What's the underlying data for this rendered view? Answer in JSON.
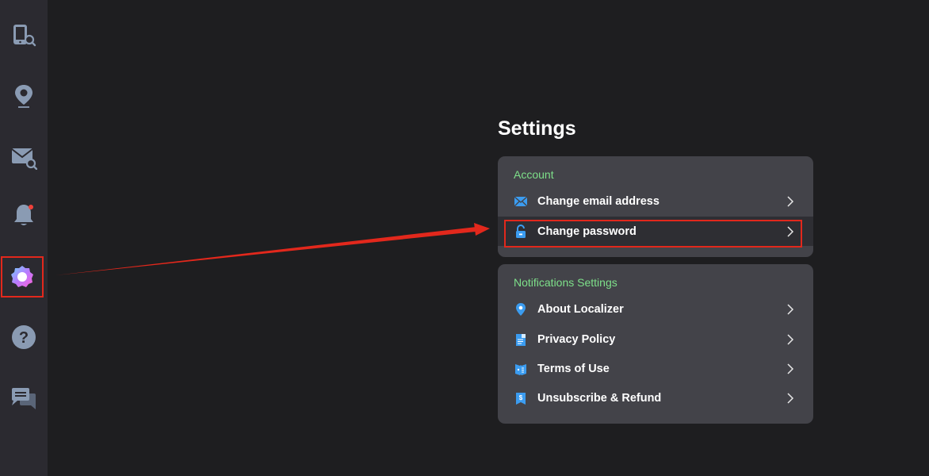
{
  "sidebar": {
    "items": [
      {
        "name": "device-search",
        "icon": "phone-search-icon",
        "active": false
      },
      {
        "name": "location",
        "icon": "map-pin-icon",
        "active": false
      },
      {
        "name": "mail-search",
        "icon": "mail-search-icon",
        "active": false
      },
      {
        "name": "notifications",
        "icon": "bell-icon",
        "active": false,
        "badge": true
      },
      {
        "name": "settings",
        "icon": "gear-icon",
        "active": true
      },
      {
        "name": "help",
        "icon": "help-icon",
        "active": false
      },
      {
        "name": "chat",
        "icon": "chat-icon",
        "active": false
      }
    ]
  },
  "page": {
    "title": "Settings"
  },
  "account": {
    "section_label": "Account",
    "items": [
      {
        "label": "Change email address",
        "icon": "envelope-icon"
      },
      {
        "label": "Change password",
        "icon": "unlock-icon"
      }
    ]
  },
  "notifications": {
    "section_label": "Notifications Settings",
    "items": [
      {
        "label": "About Localizer",
        "icon": "map-pin-icon"
      },
      {
        "label": "Privacy Policy",
        "icon": "document-icon"
      },
      {
        "label": "Terms of Use",
        "icon": "book-icon"
      },
      {
        "label": "Unsubscribe & Refund",
        "icon": "receipt-icon"
      }
    ]
  },
  "colors": {
    "accent_green": "#7ee08a",
    "icon_blue": "#3b9cf0",
    "annotation_red": "#e2281c",
    "sidebar_icon": "#8a9bb3"
  }
}
